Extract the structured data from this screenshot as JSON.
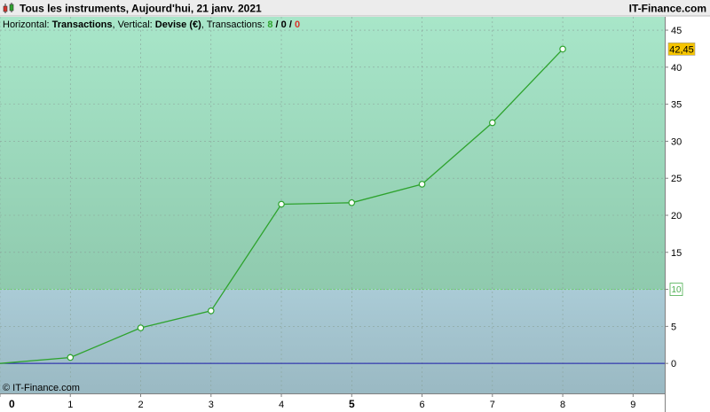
{
  "header": {
    "title": "Tous les instruments, Aujourd'hui, 21 janv. 2021",
    "brand": "IT-Finance.com"
  },
  "subheader": {
    "horizontal_label": "Horizontal: ",
    "horizontal_value": "Transactions",
    "vertical_label": ", Vertical: ",
    "vertical_value": "Devise (€)",
    "transactions_label": ", Transactions: ",
    "count_green": "8",
    "sep1": " / ",
    "count_black": "0",
    "sep2": " / ",
    "count_red": "0"
  },
  "watermark": "© IT-Finance.com",
  "colors": {
    "upper_zone_top": "#a8e6c9",
    "upper_zone_bottom": "#8fcaae",
    "lower_zone_top": "#aacbd6",
    "lower_zone_bottom": "#9ab9c3",
    "line": "#2ea32e",
    "baseline": "#1a1aa8",
    "threshold_line": "#6fd16f",
    "last_value_bg": "#f5c400",
    "threshold_text": "#4caf50"
  },
  "chart_data": {
    "type": "line",
    "x": [
      0,
      1,
      2,
      3,
      4,
      5,
      6,
      7,
      8
    ],
    "y": [
      0,
      0.8,
      4.8,
      7.1,
      21.5,
      21.7,
      24.2,
      32.5,
      42.45
    ],
    "x_ticks": [
      "0",
      "1",
      "2",
      "3",
      "4",
      "5",
      "6",
      "7",
      "8",
      "9"
    ],
    "y_ticks": [
      "0",
      "5",
      "10",
      "15",
      "20",
      "25",
      "30",
      "35",
      "40",
      "45"
    ],
    "xlim": [
      0,
      9.45
    ],
    "ylim": [
      -4.05,
      46.8
    ],
    "threshold": 10,
    "threshold_label": "10",
    "last_value_label": "42,45",
    "grid": true
  }
}
